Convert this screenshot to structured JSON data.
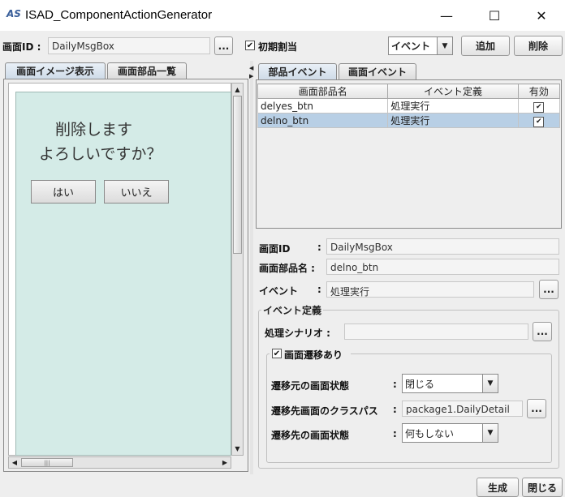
{
  "window": {
    "icon_text": "AS",
    "title": "ISAD_ComponentActionGenerator",
    "minimize_glyph": "—",
    "maximize_glyph": "☐",
    "close_glyph": "✕"
  },
  "toolbar": {
    "screen_id_label": "画面ID :",
    "screen_id_value": "DailyMsgBox",
    "browse_label": "...",
    "initial_assign_label": "初期割当",
    "initial_assign_checked": "✔",
    "type_select_value": "イベント",
    "add_label": "追加",
    "delete_label": "削除"
  },
  "left_tabs": [
    {
      "label": "画面イメージ表示"
    },
    {
      "label": "画面部品一覧"
    }
  ],
  "preview": {
    "message_line1": "削除します",
    "message_line2": "よろしいですか？",
    "yes_button": "はい",
    "no_button": "いいえ",
    "hscroll_grip": "|||"
  },
  "right_tabs": [
    {
      "label": "部品イベント"
    },
    {
      "label": "画面イベント"
    }
  ],
  "event_table": {
    "columns": [
      "画面部品名",
      "イベント定義",
      "有効"
    ],
    "rows": [
      {
        "component": "delyes_btn",
        "event": "処理実行",
        "enabled": "✔"
      },
      {
        "component": "delno_btn",
        "event": "処理実行",
        "enabled": "✔"
      }
    ]
  },
  "detail": {
    "screen_id_label": "画面ID",
    "screen_id_colon": ":",
    "screen_id_value": "DailyMsgBox",
    "component_label": "画面部品名 :",
    "component_value": "delno_btn",
    "event_label": "イベント",
    "event_colon": ":",
    "event_value": "処理実行",
    "event_browse": "...",
    "event_def_group": "イベント定義",
    "scenario_label": "処理シナリオ :",
    "scenario_value": "",
    "scenario_browse": "...",
    "transition_group": "画面遷移あり",
    "transition_checked": "✔",
    "src_state_label": "遷移元の画面状態",
    "src_state_colon": ":",
    "src_state_value": "閉じる",
    "dest_class_label": "遷移先画面のクラスパス",
    "dest_class_colon": ":",
    "dest_class_value": "package1.DailyDetail",
    "dest_class_browse": "...",
    "dest_state_label": "遷移先の画面状態",
    "dest_state_colon": ":",
    "dest_state_value": "何もしない"
  },
  "footer": {
    "generate_label": "生成",
    "close_label": "閉じる"
  }
}
